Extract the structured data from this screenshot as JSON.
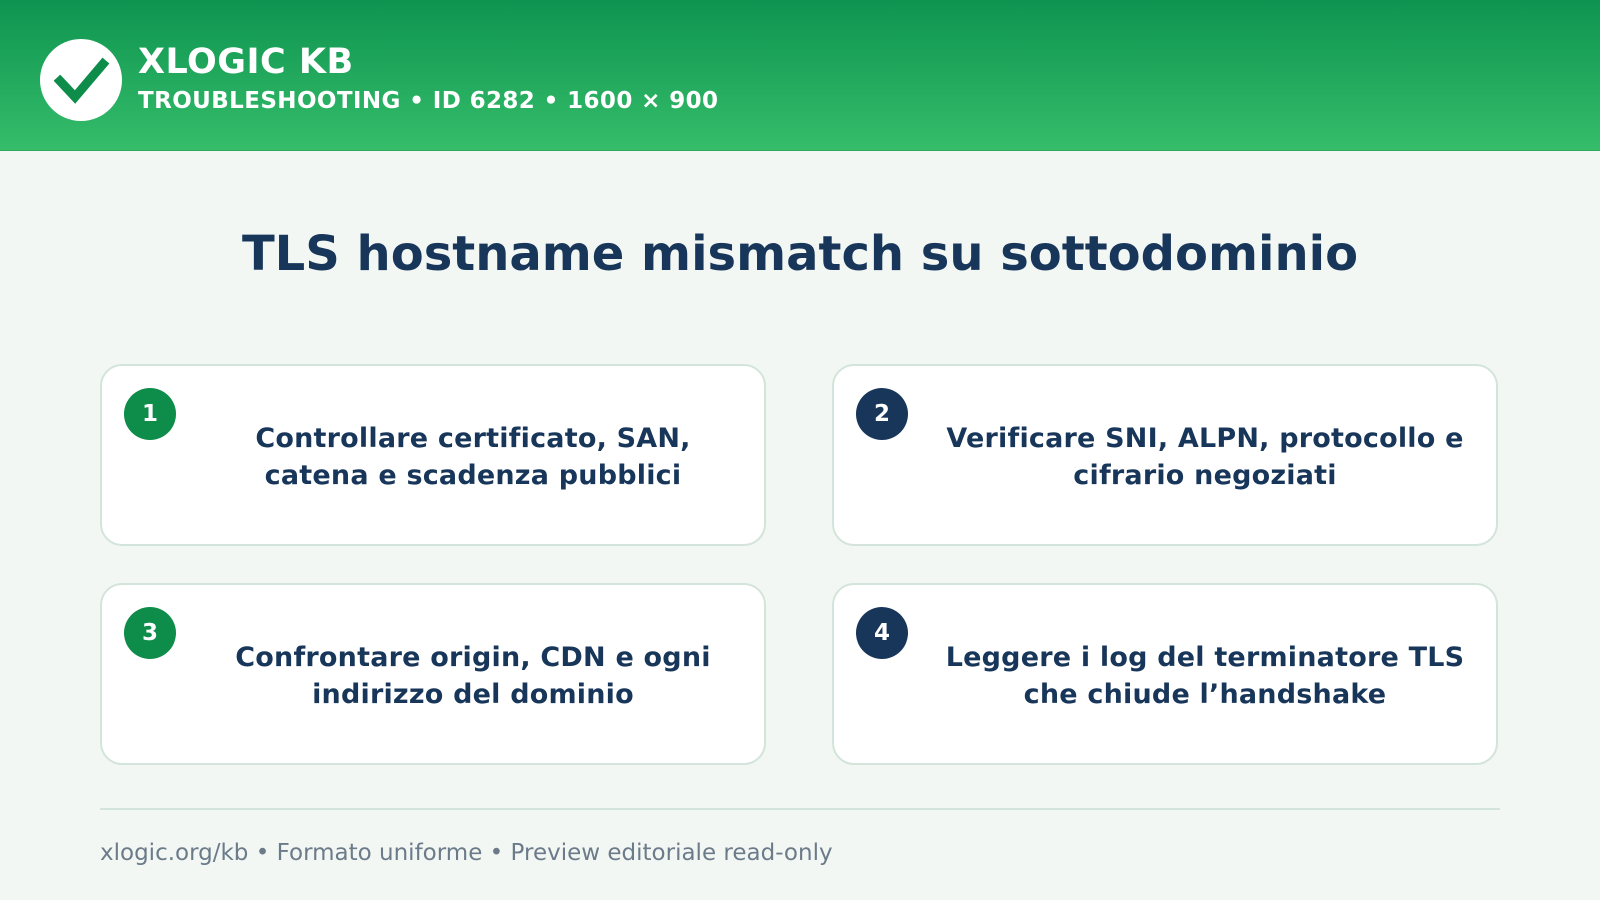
{
  "header": {
    "brand": "XLOGIC KB",
    "subtitle": "TROUBLESHOOTING • ID 6282 • 1600 × 900",
    "logo_icon": "checkmark-icon"
  },
  "main": {
    "title": "TLS hostname mismatch su sottodominio",
    "steps": [
      {
        "number": "1",
        "text": "Controllare certificato, SAN, catena e scadenza pubblici",
        "badge_color": "#0e8c4a"
      },
      {
        "number": "2",
        "text": "Verificare SNI, ALPN, protocollo e cifrario negoziati",
        "badge_color": "#17365a"
      },
      {
        "number": "3",
        "text": "Confrontare origin, CDN e ogni indirizzo del dominio",
        "badge_color": "#0e8c4a"
      },
      {
        "number": "4",
        "text": "Leggere i log del terminatore TLS che chiude l’handshake",
        "badge_color": "#17365a"
      }
    ]
  },
  "footer": {
    "text": "xlogic.org/kb • Formato uniforme • Preview editoriale read-only"
  },
  "colors": {
    "header_green": "#0e9450",
    "accent_green": "#0e8c4a",
    "navy": "#17365a",
    "background": "#f3f7f4"
  }
}
